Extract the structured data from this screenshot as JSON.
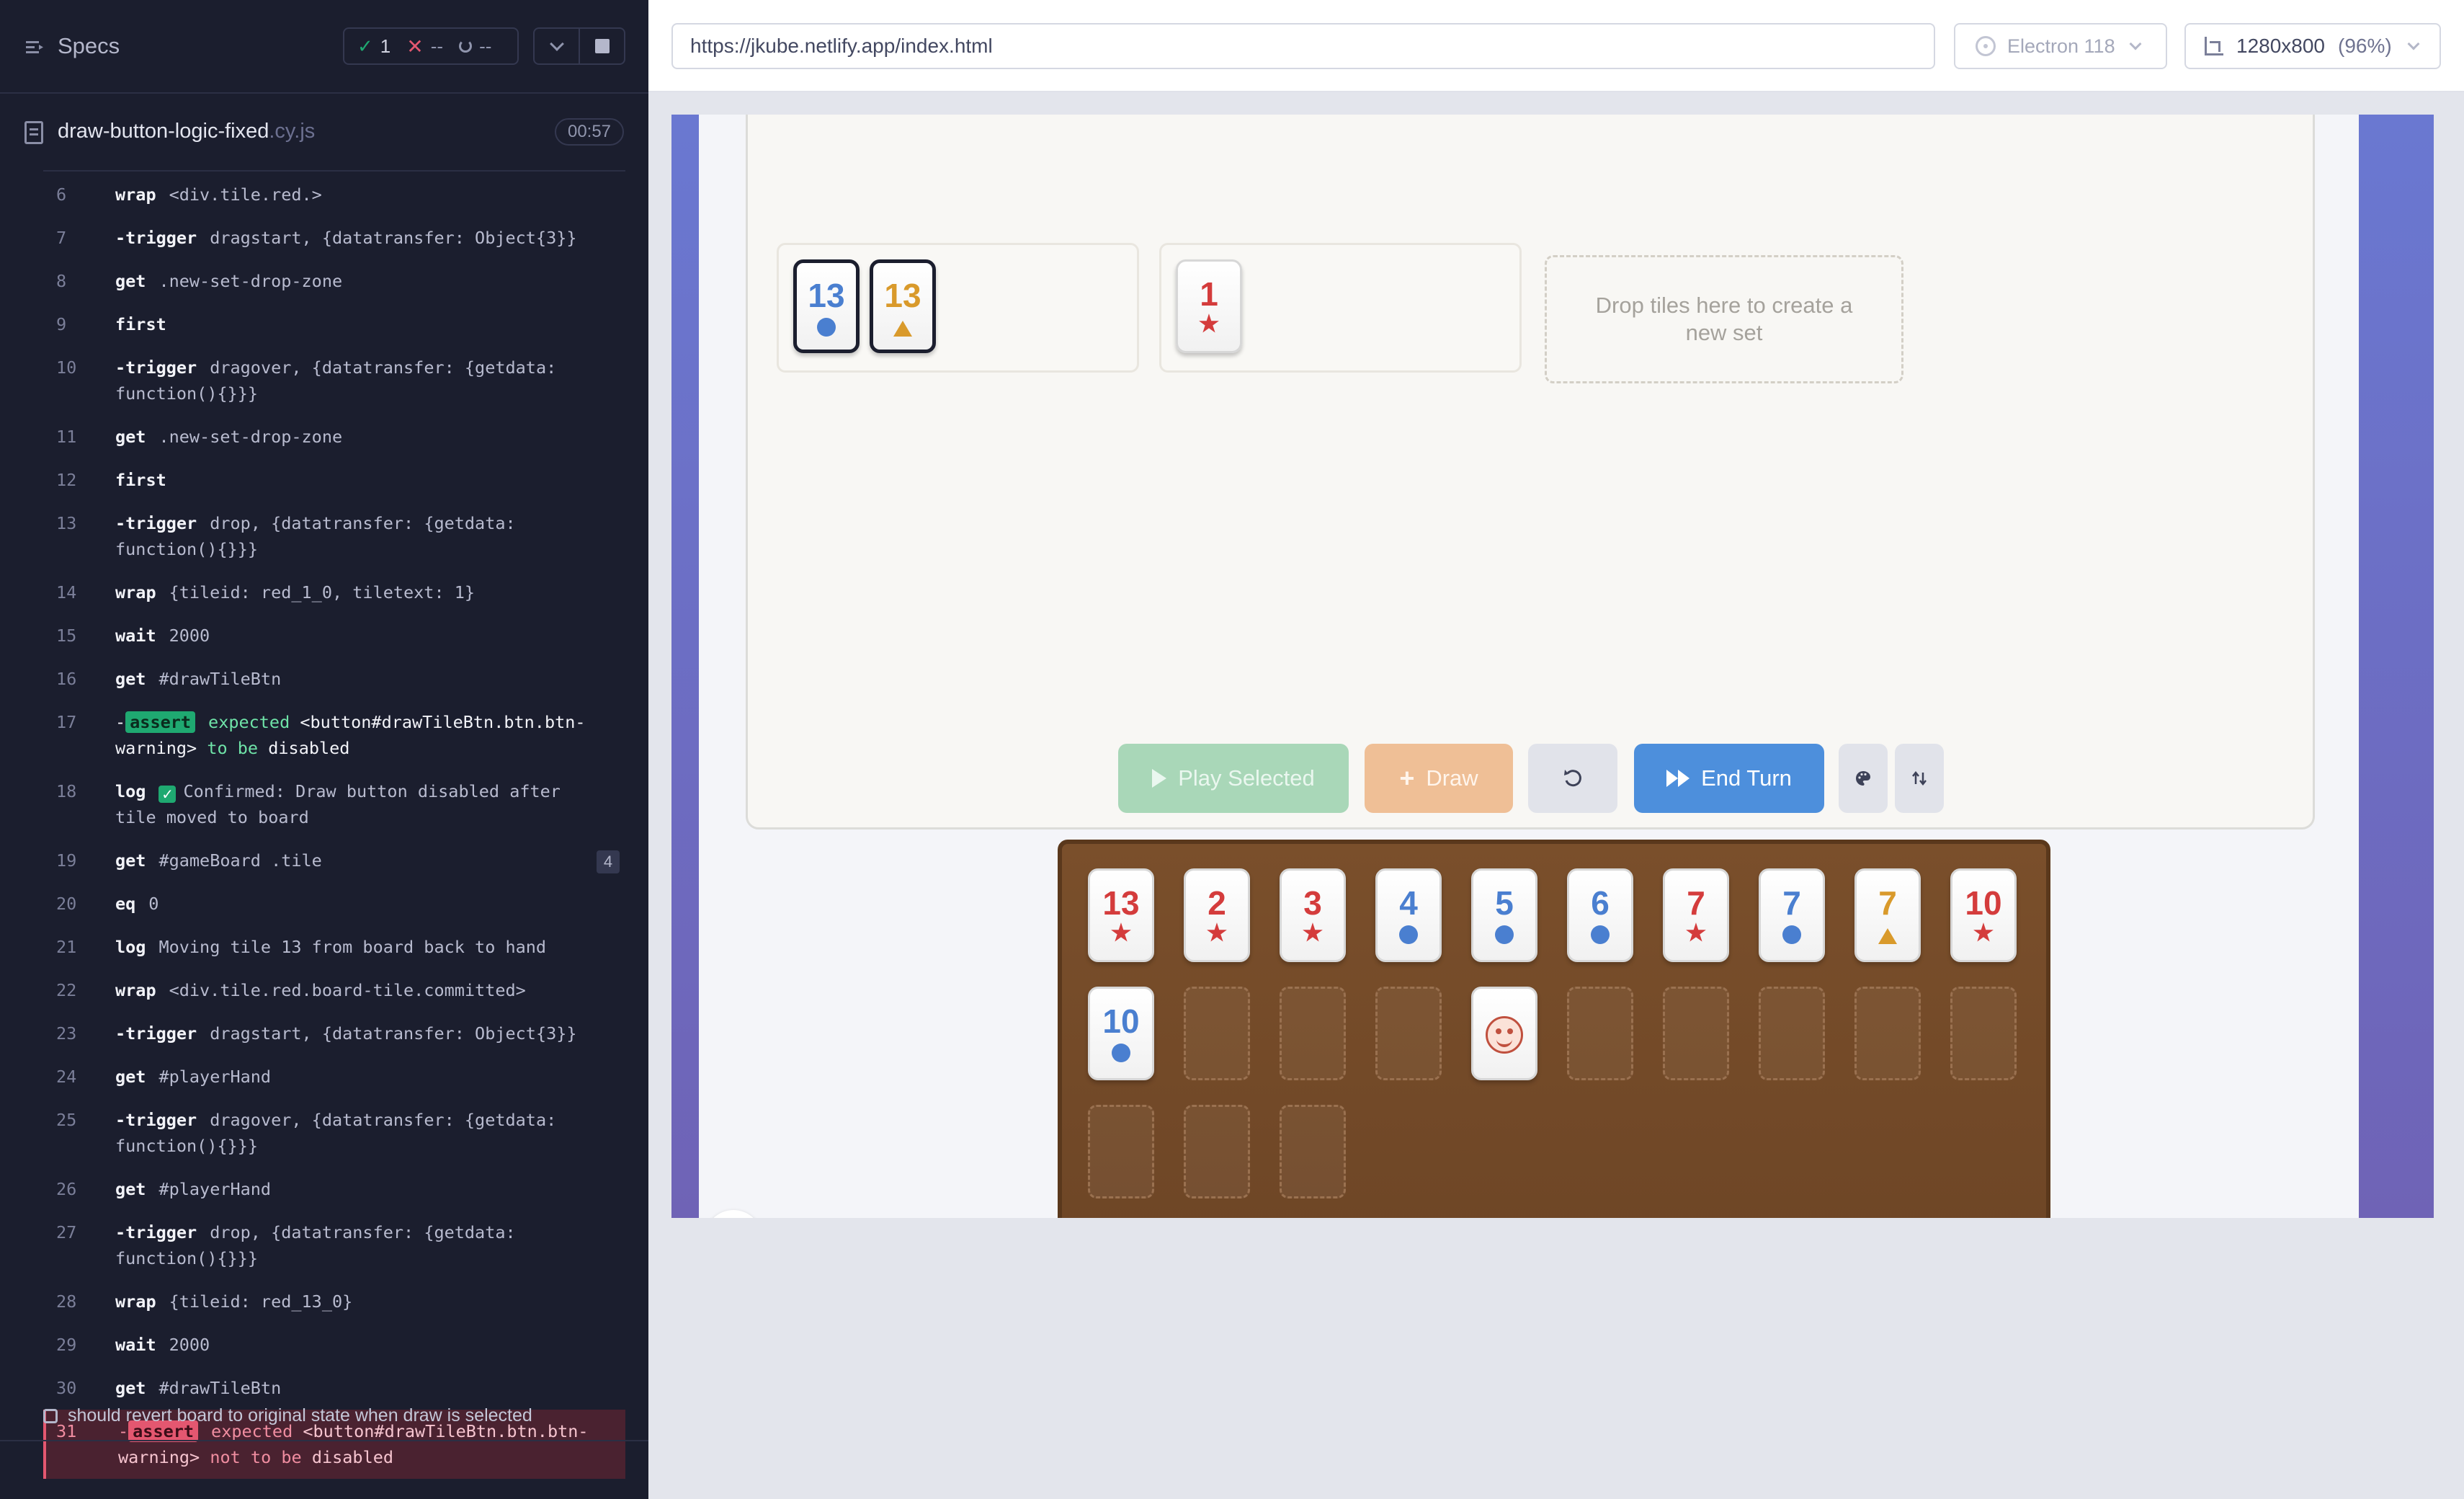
{
  "reporter": {
    "title": "Specs",
    "stats": {
      "passed": "1",
      "failed": "--",
      "pending": "--"
    },
    "file": {
      "name": "draw-button-logic-fixed",
      "ext": ".cy.js",
      "duration": "00:57"
    },
    "commands": [
      {
        "n": "6",
        "name": "wrap",
        "msg": "<div.tile.red.>"
      },
      {
        "n": "7",
        "name": "trigger",
        "child": true,
        "msg": "dragstart, {datatransfer: Object{3}}"
      },
      {
        "n": "8",
        "name": "get",
        "msg": ".new-set-drop-zone"
      },
      {
        "n": "9",
        "name": "first",
        "msg": ""
      },
      {
        "n": "10",
        "name": "trigger",
        "child": true,
        "msg": "dragover, {datatransfer: {getdata: function(){}}}"
      },
      {
        "n": "11",
        "name": "get",
        "msg": ".new-set-drop-zone"
      },
      {
        "n": "12",
        "name": "first",
        "msg": ""
      },
      {
        "n": "13",
        "name": "trigger",
        "child": true,
        "msg": "drop, {datatransfer: {getdata: function(){}}}"
      },
      {
        "n": "14",
        "name": "wrap",
        "msg": "{tileid: red_1_0, tiletext: 1}"
      },
      {
        "n": "15",
        "name": "wait",
        "msg": "2000"
      },
      {
        "n": "16",
        "name": "get",
        "msg": "#drawTileBtn"
      },
      {
        "n": "17",
        "assert": "pass",
        "badge": "assert",
        "parts": [
          "expected",
          "<button#drawTileBtn.btn.btn-warning>",
          "to be",
          "disabled"
        ]
      },
      {
        "n": "18",
        "name": "log",
        "emoji": true,
        "msg": "Confirmed: Draw button disabled after tile moved to board"
      },
      {
        "n": "19",
        "name": "get",
        "msg": "#gameBoard .tile",
        "count": "4"
      },
      {
        "n": "20",
        "name": "eq",
        "msg": "0"
      },
      {
        "n": "21",
        "name": "log",
        "msg": "Moving tile 13 from board back to hand"
      },
      {
        "n": "22",
        "name": "wrap",
        "msg": "<div.tile.red.board-tile.committed>"
      },
      {
        "n": "23",
        "name": "trigger",
        "child": true,
        "msg": "dragstart, {datatransfer: Object{3}}"
      },
      {
        "n": "24",
        "name": "get",
        "msg": "#playerHand"
      },
      {
        "n": "25",
        "name": "trigger",
        "child": true,
        "msg": "dragover, {datatransfer: {getdata: function(){}}}"
      },
      {
        "n": "26",
        "name": "get",
        "msg": "#playerHand"
      },
      {
        "n": "27",
        "name": "trigger",
        "child": true,
        "msg": "drop, {datatransfer: {getdata: function(){}}}"
      },
      {
        "n": "28",
        "name": "wrap",
        "msg": "{tileid: red_13_0}"
      },
      {
        "n": "29",
        "name": "wait",
        "msg": "2000"
      },
      {
        "n": "30",
        "name": "get",
        "msg": "#drawTileBtn"
      },
      {
        "n": "31",
        "assert": "fail",
        "badge": "assert",
        "parts": [
          "expected",
          "<button#drawTileBtn.btn.btn-warning>",
          "not to be",
          "disabled"
        ]
      }
    ],
    "next_test": "should revert board to original state when draw is selected"
  },
  "browser": {
    "url": "https://jkube.netlify.app/index.html",
    "browser_name": "Electron 118",
    "viewport": "1280x800",
    "scale": "(96%)"
  },
  "game": {
    "drop_zone_text": "Drop tiles here to create a new set",
    "buttons": {
      "play": "Play Selected",
      "draw": "Draw",
      "end": "End Turn"
    },
    "colors": {
      "blue": "#4a7fd0",
      "red": "#d43c3c",
      "orange": "#d99a2b"
    },
    "board_sets": [
      [
        {
          "value": "13",
          "color": "blue",
          "symbol": "circle",
          "selected": true
        },
        {
          "value": "13",
          "color": "orange",
          "symbol": "triangle",
          "selected": true
        }
      ],
      [
        {
          "value": "1",
          "color": "red",
          "symbol": "star"
        }
      ]
    ],
    "hand_row1": [
      {
        "value": "13",
        "color": "red",
        "symbol": "star"
      },
      {
        "value": "2",
        "color": "red",
        "symbol": "star"
      },
      {
        "value": "3",
        "color": "red",
        "symbol": "star"
      },
      {
        "value": "4",
        "color": "blue",
        "symbol": "circle"
      },
      {
        "value": "5",
        "color": "blue",
        "symbol": "circle"
      },
      {
        "value": "6",
        "color": "blue",
        "symbol": "circle"
      },
      {
        "value": "7",
        "color": "red",
        "symbol": "star"
      },
      {
        "value": "7",
        "color": "blue",
        "symbol": "circle"
      },
      {
        "value": "7",
        "color": "orange",
        "symbol": "triangle"
      },
      {
        "value": "10",
        "color": "red",
        "symbol": "star"
      }
    ],
    "hand_row2": [
      {
        "value": "10",
        "color": "blue",
        "symbol": "circle"
      },
      null,
      null,
      null,
      {
        "joker": true
      },
      null,
      null,
      null,
      null,
      null
    ],
    "hand_row3_empty_slots": 3
  }
}
